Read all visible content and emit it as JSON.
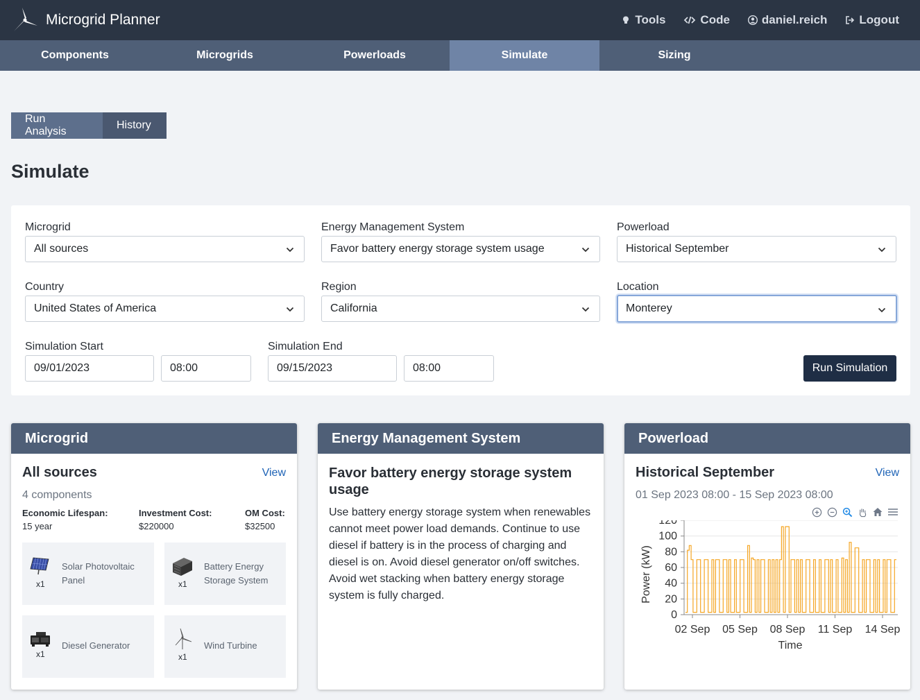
{
  "app": {
    "title": "Microgrid Planner"
  },
  "topnav": {
    "tools": "Tools",
    "code": "Code",
    "user": "daniel.reich",
    "logout": "Logout"
  },
  "tabs": [
    "Components",
    "Microgrids",
    "Powerloads",
    "Simulate",
    "Sizing"
  ],
  "active_tab": "Simulate",
  "toggle": {
    "run_analysis": "Run Analysis",
    "history": "History"
  },
  "page_title": "Simulate",
  "form": {
    "microgrid": {
      "label": "Microgrid",
      "value": "All sources"
    },
    "ems": {
      "label": "Energy Management System",
      "value": "Favor battery energy storage system usage"
    },
    "powerload": {
      "label": "Powerload",
      "value": "Historical September"
    },
    "country": {
      "label": "Country",
      "value": "United States of America"
    },
    "region": {
      "label": "Region",
      "value": "California"
    },
    "location": {
      "label": "Location",
      "value": "Monterey"
    },
    "sim_start": {
      "label": "Simulation Start",
      "date": "09/01/2023",
      "time": "08:00"
    },
    "sim_end": {
      "label": "Simulation End",
      "date": "09/15/2023",
      "time": "08:00"
    },
    "run_button": "Run Simulation"
  },
  "microgrid_card": {
    "header": "Microgrid",
    "title": "All sources",
    "view": "View",
    "subtitle": "4 components",
    "stats": [
      {
        "label": "Economic Lifespan:",
        "value": "15 year"
      },
      {
        "label": "Investment Cost:",
        "value": "$220000"
      },
      {
        "label": "OM Cost:",
        "value": "$32500"
      }
    ],
    "components": [
      {
        "name": "Solar Photovoltaic Panel",
        "qty": "x1",
        "icon": "solar-panel-icon"
      },
      {
        "name": "Battery Energy Storage System",
        "qty": "x1",
        "icon": "battery-icon"
      },
      {
        "name": "Diesel Generator",
        "qty": "x1",
        "icon": "generator-icon"
      },
      {
        "name": "Wind Turbine",
        "qty": "x1",
        "icon": "wind-turbine-icon"
      }
    ]
  },
  "ems_card": {
    "header": "Energy Management System",
    "title": "Favor battery energy storage system usage",
    "description": "Use battery energy storage system when renewables cannot meet power load demands. Continue to use diesel if battery is in the process of charging and diesel is on. Avoid diesel generator on/off switches. Avoid wet stacking when battery energy storage system is fully charged."
  },
  "powerload_card": {
    "header": "Powerload",
    "title": "Historical September",
    "view": "View",
    "range": "01 Sep 2023 08:00 - 15 Sep 2023 08:00"
  },
  "chart_data": {
    "type": "line",
    "xlabel": "Time",
    "ylabel": "Power (kW)",
    "ylim": [
      0,
      120
    ],
    "yticks": [
      0,
      20,
      40,
      60,
      80,
      100,
      120
    ],
    "xticks": [
      "02 Sep",
      "05 Sep",
      "08 Sep",
      "11 Sep",
      "14 Sep"
    ],
    "xlim": [
      "01 Sep 08:00",
      "15 Sep 08:00"
    ],
    "series_color": "#f5a623",
    "series": [
      {
        "values": [
          3,
          82,
          88,
          70,
          3,
          3,
          70,
          70,
          3,
          3,
          70,
          70,
          3,
          3,
          70,
          3,
          70,
          70,
          3,
          3,
          70,
          70,
          3,
          70,
          3,
          3,
          70,
          3,
          3,
          70,
          70,
          3,
          3,
          88,
          3,
          72,
          70,
          3,
          70,
          3,
          70,
          70,
          3,
          3,
          70,
          3,
          70,
          3,
          70,
          3,
          70,
          112,
          3,
          112,
          112,
          3,
          70,
          70,
          3,
          70,
          3,
          70,
          3,
          3,
          70,
          70,
          3,
          3,
          70,
          3,
          3,
          70,
          3,
          3,
          70,
          70,
          3,
          70,
          3,
          3,
          70,
          3,
          3,
          72,
          3,
          70,
          3,
          92,
          3,
          3,
          85,
          85,
          3,
          3,
          70,
          3,
          70,
          70,
          3,
          3,
          70,
          3,
          70,
          3,
          3,
          70,
          3,
          70,
          70,
          3,
          3,
          70
        ]
      }
    ],
    "grid": true
  },
  "colors": {
    "topbar": "#2b3544",
    "secnav": "#4f5f77",
    "active_tab": "#6f84a6",
    "primary": "#1f2e45",
    "link": "#1e63b6"
  }
}
